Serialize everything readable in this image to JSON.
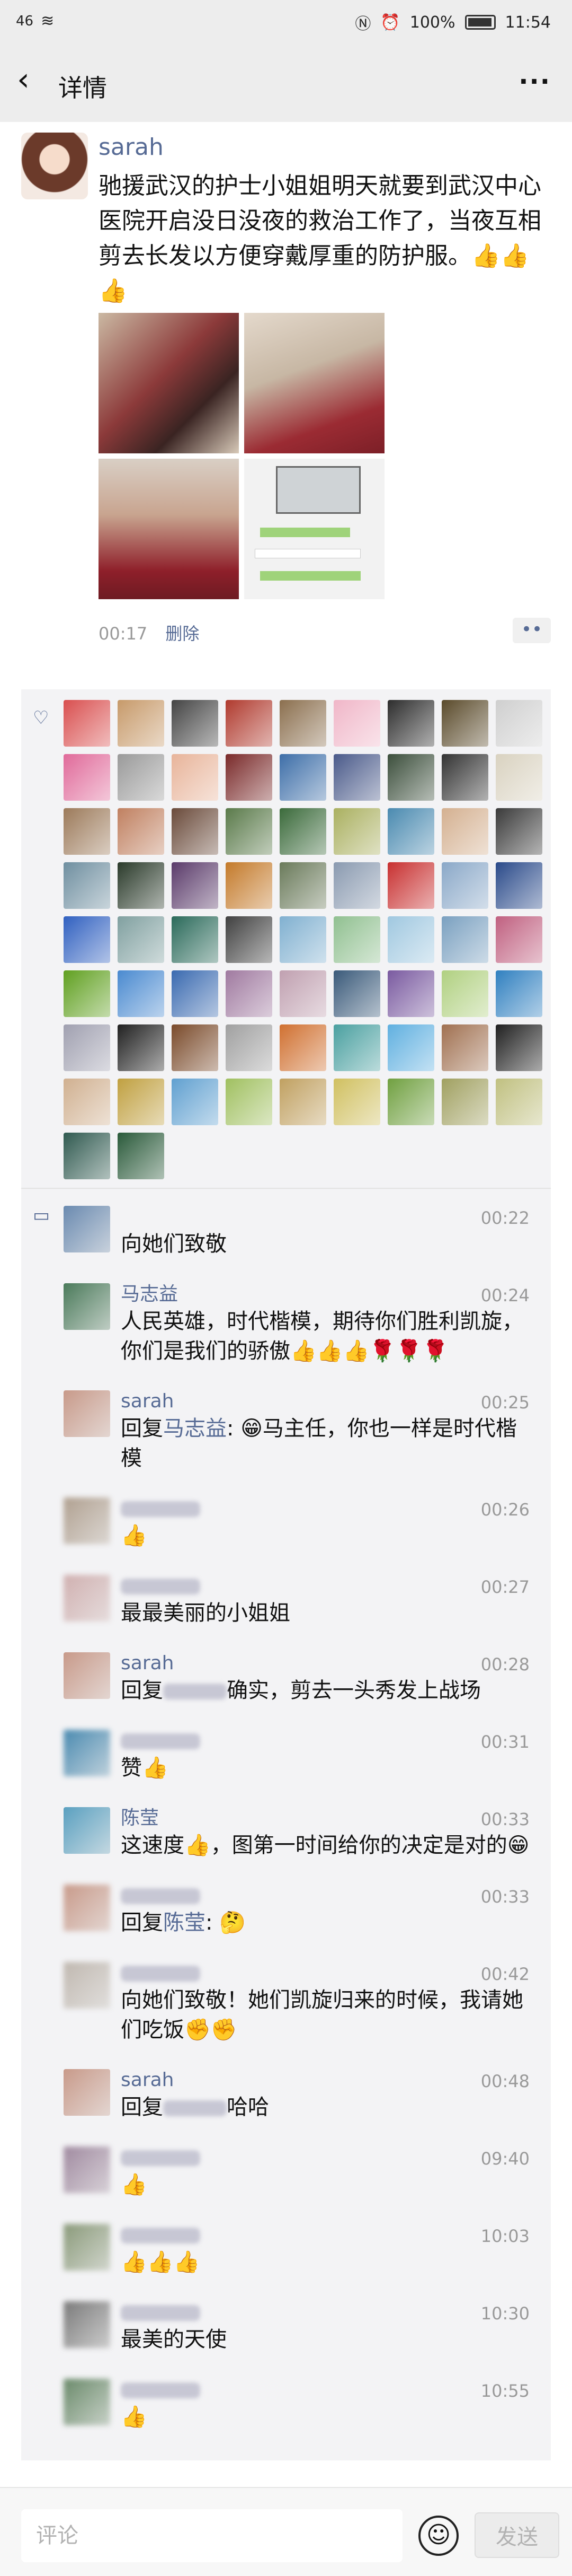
{
  "status_bar": {
    "signal": "46",
    "battery": "100%",
    "time": "11:54"
  },
  "nav": {
    "back_icon": "chevron-left-icon",
    "title": "详情",
    "more_icon": "more-dots-icon"
  },
  "post": {
    "author": "sarah",
    "text": "驰援武汉的护士小姐姐明天就要到武汉中心医院开启没日没夜的救治工作了，当夜互相剪去长发以方便穿戴厚重的防护服。👍👍👍",
    "time": "00:17",
    "delete_label": "删除",
    "more_button": "••"
  },
  "like_colors": [
    "#d94f4f",
    "#c79a6a",
    "#444444",
    "#b03a2e",
    "#8b6f4e",
    "#f0b6c8",
    "#2d2d2d",
    "#5a4a2a",
    "#cfcfcf",
    "#e06a9a",
    "#9a9a9a",
    "#e8b49a",
    "#7a2a2a",
    "#3d6ea8",
    "#4a5a8a",
    "#3c4f3c",
    "#333333",
    "#d9d2c0",
    "#9c7a5a",
    "#c08060",
    "#6a4a3a",
    "#5a7a4a",
    "#3a6a3a",
    "#aab060",
    "#4a8ab0",
    "#d4b090",
    "#3a3a3a",
    "#6f8fa0",
    "#2a3a2a",
    "#5a3a6a",
    "#c47a2a",
    "#6a7a5a",
    "#8a9ab0",
    "#c83030",
    "#8aa8c8",
    "#2a4a8a",
    "#3060c0",
    "#80a0a0",
    "#2a6a5a",
    "#404040",
    "#80b0d0",
    "#90c090",
    "#a0c8e0",
    "#7aa0c0",
    "#c06080",
    "#60a020",
    "#4a8ad0",
    "#3a6ab0",
    "#a07aa0",
    "#c0a0b0",
    "#3a5a7a",
    "#7a5aa0",
    "#b0d080",
    "#3080c0",
    "#a0a0b0",
    "#202020",
    "#7a4a2a",
    "#a0a0a0",
    "#d07030",
    "#4aa0a0",
    "#60b0e0",
    "#a07050",
    "#202020",
    "#d0b090",
    "#c0a040",
    "#60a0d0",
    "#a0c060",
    "#c0a060",
    "#d0c060",
    "#70a040",
    "#a0a060",
    "#c0c080",
    "#305a50",
    "#2a5a3a"
  ],
  "comments": [
    {
      "name": "",
      "time": "00:22",
      "text": "向她们致敬",
      "avatar": "#6a8ab0",
      "blur": false
    },
    {
      "name": "马志益",
      "time": "00:24",
      "text": "人民英雄，时代楷模，期待你们胜利凯旋，你们是我们的骄傲👍👍👍🌹🌹🌹",
      "avatar": "#4a7a5a",
      "blur": false
    },
    {
      "name": "sarah",
      "time": "00:25",
      "reply_prefix": "回复",
      "reply_to": "马志益",
      "text": ": 😁马主任，你也一样是时代楷模",
      "avatar": "#c89a8a",
      "blur": false
    },
    {
      "name": "",
      "time": "00:26",
      "text": "👍",
      "avatar": "#b0a090",
      "blur": true
    },
    {
      "name": "",
      "time": "00:27",
      "text": "最最美丽的小姐姐",
      "avatar": "#d0b0b0",
      "blur": true
    },
    {
      "name": "sarah",
      "time": "00:28",
      "reply_prefix": "回复",
      "reply_to": "",
      "text": "确实，剪去一头秀发上战场",
      "avatar": "#c89a8a",
      "blur": false
    },
    {
      "name": "",
      "time": "00:31",
      "text": "赞👍",
      "avatar": "#4a8ab0",
      "blur": true
    },
    {
      "name": "陈莹",
      "time": "00:33",
      "text": "这速度👍，图第一时间给你的决定是对的😁",
      "avatar": "#5aa0c0",
      "blur": false
    },
    {
      "name": "",
      "time": "00:33",
      "reply_prefix": "回复",
      "reply_to": "陈莹",
      "text": ": 🤔",
      "avatar": "#c89a8a",
      "blur": true
    },
    {
      "name": "",
      "time": "00:42",
      "text": "向她们致敬！她们凯旋归来的时候，我请她们吃饭✊✊",
      "avatar": "#c0b8b0",
      "blur": true
    },
    {
      "name": "sarah",
      "time": "00:48",
      "reply_prefix": "回复",
      "reply_to": "",
      "text": "哈哈",
      "avatar": "#c89a8a",
      "blur": false
    },
    {
      "name": "",
      "time": "09:40",
      "text": "👍",
      "avatar": "#a08aa0",
      "blur": true
    },
    {
      "name": "",
      "time": "10:03",
      "text": "👍👍👍",
      "avatar": "#8a9a7a",
      "blur": true
    },
    {
      "name": "",
      "time": "10:30",
      "text": "最美的天使",
      "avatar": "#7a7a7a",
      "blur": true
    },
    {
      "name": "",
      "time": "10:55",
      "text": "👍",
      "avatar": "#6a8a6a",
      "blur": true
    }
  ],
  "input": {
    "placeholder": "评论",
    "emoji_icon": "emoji-icon",
    "send_label": "发送"
  }
}
